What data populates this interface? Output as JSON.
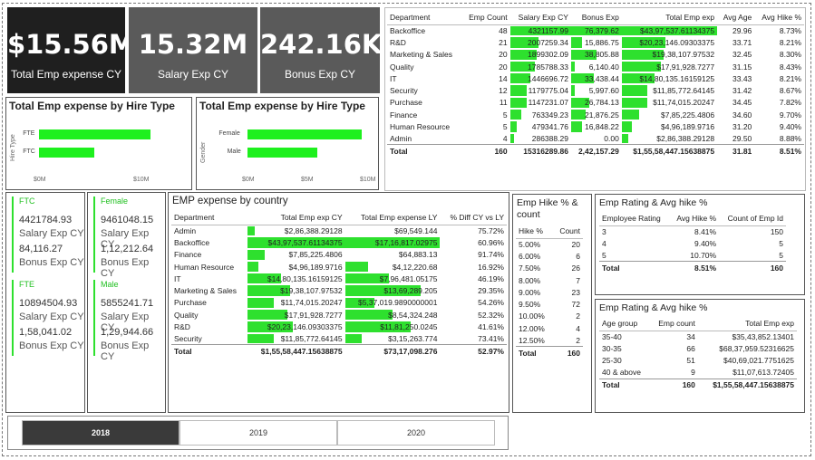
{
  "kpis": [
    {
      "value": "$15.56M",
      "label": "Total Emp expense CY"
    },
    {
      "value": "15.32M",
      "label": "Salary Exp CY"
    },
    {
      "value": "242.16K",
      "label": "Bonus Exp CY"
    }
  ],
  "dept_table": {
    "headers": [
      "Department",
      "Emp Count",
      "Salary Exp CY",
      "Bonus Exp",
      "Total Emp exp",
      "Avg Age",
      "Avg Hike %"
    ],
    "rows": [
      {
        "dept": "Backoffice",
        "count": "48",
        "salary": "4321157.99",
        "salary_pct": 1.0,
        "bonus": "76,379.62",
        "bonus_pct": 1.0,
        "total": "$43,97,537.61134375",
        "total_pct": 1.0,
        "age": "29.96",
        "hike": "8.73%"
      },
      {
        "dept": "R&D",
        "count": "21",
        "salary": "2007259.34",
        "salary_pct": 0.46,
        "bonus": "15,886.75",
        "bonus_pct": 0.21,
        "total": "$20,23,146.09303375",
        "total_pct": 0.46,
        "age": "33.71",
        "hike": "8.21%"
      },
      {
        "dept": "Marketing & Sales",
        "count": "20",
        "salary": "1899302.09",
        "salary_pct": 0.44,
        "bonus": "38,805.88",
        "bonus_pct": 0.51,
        "total": "$19,38,107.97532",
        "total_pct": 0.44,
        "age": "32.45",
        "hike": "8.30%"
      },
      {
        "dept": "Quality",
        "count": "20",
        "salary": "1785788.33",
        "salary_pct": 0.41,
        "bonus": "6,140.40",
        "bonus_pct": 0.08,
        "total": "$17,91,928.7277",
        "total_pct": 0.41,
        "age": "31.15",
        "hike": "8.43%"
      },
      {
        "dept": "IT",
        "count": "14",
        "salary": "1446696.72",
        "salary_pct": 0.33,
        "bonus": "33,438.44",
        "bonus_pct": 0.44,
        "total": "$14,80,135.16159125",
        "total_pct": 0.34,
        "age": "33.43",
        "hike": "8.21%"
      },
      {
        "dept": "Security",
        "count": "12",
        "salary": "1179775.04",
        "salary_pct": 0.27,
        "bonus": "5,997.60",
        "bonus_pct": 0.08,
        "total": "$11,85,772.64145",
        "total_pct": 0.27,
        "age": "31.42",
        "hike": "8.67%"
      },
      {
        "dept": "Purchase",
        "count": "11",
        "salary": "1147231.07",
        "salary_pct": 0.27,
        "bonus": "26,784.13",
        "bonus_pct": 0.35,
        "total": "$11,74,015.20247",
        "total_pct": 0.27,
        "age": "34.45",
        "hike": "7.82%"
      },
      {
        "dept": "Finance",
        "count": "5",
        "salary": "763349.23",
        "salary_pct": 0.18,
        "bonus": "21,876.25",
        "bonus_pct": 0.29,
        "total": "$7,85,225.4806",
        "total_pct": 0.18,
        "age": "34.60",
        "hike": "9.70%"
      },
      {
        "dept": "Human Resource",
        "count": "5",
        "salary": "479341.76",
        "salary_pct": 0.11,
        "bonus": "16,848.22",
        "bonus_pct": 0.22,
        "total": "$4,96,189.9716",
        "total_pct": 0.11,
        "age": "31.20",
        "hike": "9.40%"
      },
      {
        "dept": "Admin",
        "count": "4",
        "salary": "286388.29",
        "salary_pct": 0.07,
        "bonus": "0.00",
        "bonus_pct": 0.0,
        "total": "$2,86,388.29128",
        "total_pct": 0.07,
        "age": "29.50",
        "hike": "8.88%"
      }
    ],
    "total": {
      "dept": "Total",
      "count": "160",
      "salary": "15316289.86",
      "bonus": "2,42,157.29",
      "total": "$1,55,58,447.15638875",
      "age": "31.81",
      "hike": "8.51%"
    }
  },
  "hire_chart": {
    "title": "Total Emp expense by Hire Type",
    "axis_title": "Hire Type",
    "categories": [
      "FTE",
      "FTC"
    ],
    "values": [
      11.3,
      5.5
    ],
    "max": 10,
    "ticks": [
      "$0M",
      "$10M"
    ]
  },
  "gender_chart": {
    "title": "Total Emp expense by Hire Type",
    "axis_title": "Gender",
    "categories": [
      "Female",
      "Male"
    ],
    "values": [
      9.7,
      5.9
    ],
    "max": 10,
    "ticks": [
      "$0M",
      "$5M",
      "$10M"
    ]
  },
  "hire_cards": [
    {
      "head": "FTC",
      "salary": "4421784.93",
      "salary_label": "Salary Exp CY",
      "bonus": "84,116.27",
      "bonus_label": "Bonus Exp CY"
    },
    {
      "head": "FTE",
      "salary": "10894504.93",
      "salary_label": "Salary Exp CY",
      "bonus": "1,58,041.02",
      "bonus_label": "Bonus Exp CY"
    }
  ],
  "gender_cards": [
    {
      "head": "Female",
      "salary": "9461048.15",
      "salary_label": "Salary Exp CY",
      "bonus": "1,12,212.64",
      "bonus_label": "Bonus Exp CY"
    },
    {
      "head": "Male",
      "salary": "5855241.71",
      "salary_label": "Salary Exp CY",
      "bonus": "1,29,944.66",
      "bonus_label": "Bonus Exp CY"
    }
  ],
  "country_table": {
    "title": "EMP expense by country",
    "headers": [
      "Department",
      "Total Emp exp CY",
      "Total Emp expense LY",
      "% Diff CY vs LY"
    ],
    "rows": [
      {
        "dept": "Admin",
        "cy": "$2,86,388.29128",
        "cy_pct": 0.07,
        "ly": "$69,549.144",
        "ly_pct": 0.0,
        "diff": "75.72%"
      },
      {
        "dept": "Backoffice",
        "cy": "$43,97,537.61134375",
        "cy_pct": 1.0,
        "ly": "$17,16,817.02975",
        "ly_pct": 1.0,
        "diff": "60.96%"
      },
      {
        "dept": "Finance",
        "cy": "$7,85,225.4806",
        "cy_pct": 0.18,
        "ly": "$64,883.13",
        "ly_pct": 0.0,
        "diff": "91.74%"
      },
      {
        "dept": "Human Resource",
        "cy": "$4,96,189.9716",
        "cy_pct": 0.11,
        "ly": "$4,12,220.68",
        "ly_pct": 0.24,
        "diff": "16.92%"
      },
      {
        "dept": "IT",
        "cy": "$14,80,135.16159125",
        "cy_pct": 0.34,
        "ly": "$7,96,481.05175",
        "ly_pct": 0.46,
        "diff": "46.19%"
      },
      {
        "dept": "Marketing & Sales",
        "cy": "$19,38,107.97532",
        "cy_pct": 0.44,
        "ly": "$13,69,289.205",
        "ly_pct": 0.8,
        "diff": "29.35%"
      },
      {
        "dept": "Purchase",
        "cy": "$11,74,015.20247",
        "cy_pct": 0.27,
        "ly": "$5,37,019.9890000001",
        "ly_pct": 0.31,
        "diff": "54.26%"
      },
      {
        "dept": "Quality",
        "cy": "$17,91,928.7277",
        "cy_pct": 0.41,
        "ly": "$8,54,324.248",
        "ly_pct": 0.5,
        "diff": "52.32%"
      },
      {
        "dept": "R&D",
        "cy": "$20,23,146.09303375",
        "cy_pct": 0.46,
        "ly": "$11,81,250.0245",
        "ly_pct": 0.69,
        "diff": "41.61%"
      },
      {
        "dept": "Security",
        "cy": "$11,85,772.64145",
        "cy_pct": 0.27,
        "ly": "$3,15,263.774",
        "ly_pct": 0.18,
        "diff": "73.41%"
      }
    ],
    "total": {
      "dept": "Total",
      "cy": "$1,55,58,447.15638875",
      "ly": "$73,17,098.276",
      "diff": "52.97%"
    }
  },
  "hike_table": {
    "title": "Emp Hike % & count",
    "headers": [
      "Hike %",
      "Count"
    ],
    "rows": [
      {
        "hike": "5.00%",
        "count": "20"
      },
      {
        "hike": "6.00%",
        "count": "6"
      },
      {
        "hike": "7.50%",
        "count": "26"
      },
      {
        "hike": "8.00%",
        "count": "7"
      },
      {
        "hike": "9.00%",
        "count": "23"
      },
      {
        "hike": "9.50%",
        "count": "72"
      },
      {
        "hike": "10.00%",
        "count": "2"
      },
      {
        "hike": "12.00%",
        "count": "4"
      },
      {
        "hike": "12.50%",
        "count": "2"
      }
    ],
    "total": {
      "hike": "Total",
      "count": "160"
    }
  },
  "rating_table": {
    "title": "Emp Rating & Avg hike %",
    "headers": [
      "Employee Rating",
      "Avg Hike %",
      "Count of Emp Id"
    ],
    "rows": [
      {
        "rating": "3",
        "hike": "8.41%",
        "count": "150"
      },
      {
        "rating": "4",
        "hike": "9.40%",
        "count": "5"
      },
      {
        "rating": "5",
        "hike": "10.70%",
        "count": "5"
      }
    ],
    "total": {
      "rating": "Total",
      "hike": "8.51%",
      "count": "160"
    }
  },
  "age_table": {
    "title": "Emp Rating & Avg hike %",
    "headers": [
      "Age group",
      "Emp count",
      "Total Emp exp"
    ],
    "rows": [
      {
        "group": "35-40",
        "count": "34",
        "total": "$35,43,852.13401"
      },
      {
        "group": "30-35",
        "count": "66",
        "total": "$68,37,959.52316625"
      },
      {
        "group": "25-30",
        "count": "51",
        "total": "$40,69,021.7751625"
      },
      {
        "group": "40 & above",
        "count": "9",
        "total": "$11,07,613.72405"
      }
    ],
    "total": {
      "group": "Total",
      "count": "160",
      "total": "$1,55,58,447.15638875"
    }
  },
  "years": {
    "items": [
      "2018",
      "2019",
      "2020"
    ],
    "selected": "2018"
  },
  "colors": {
    "accent": "#2ee02e",
    "kpi_dark": "#1f1f1f",
    "kpi_mid": "#5a5a5a",
    "selected_year": "#3a3a3a"
  }
}
